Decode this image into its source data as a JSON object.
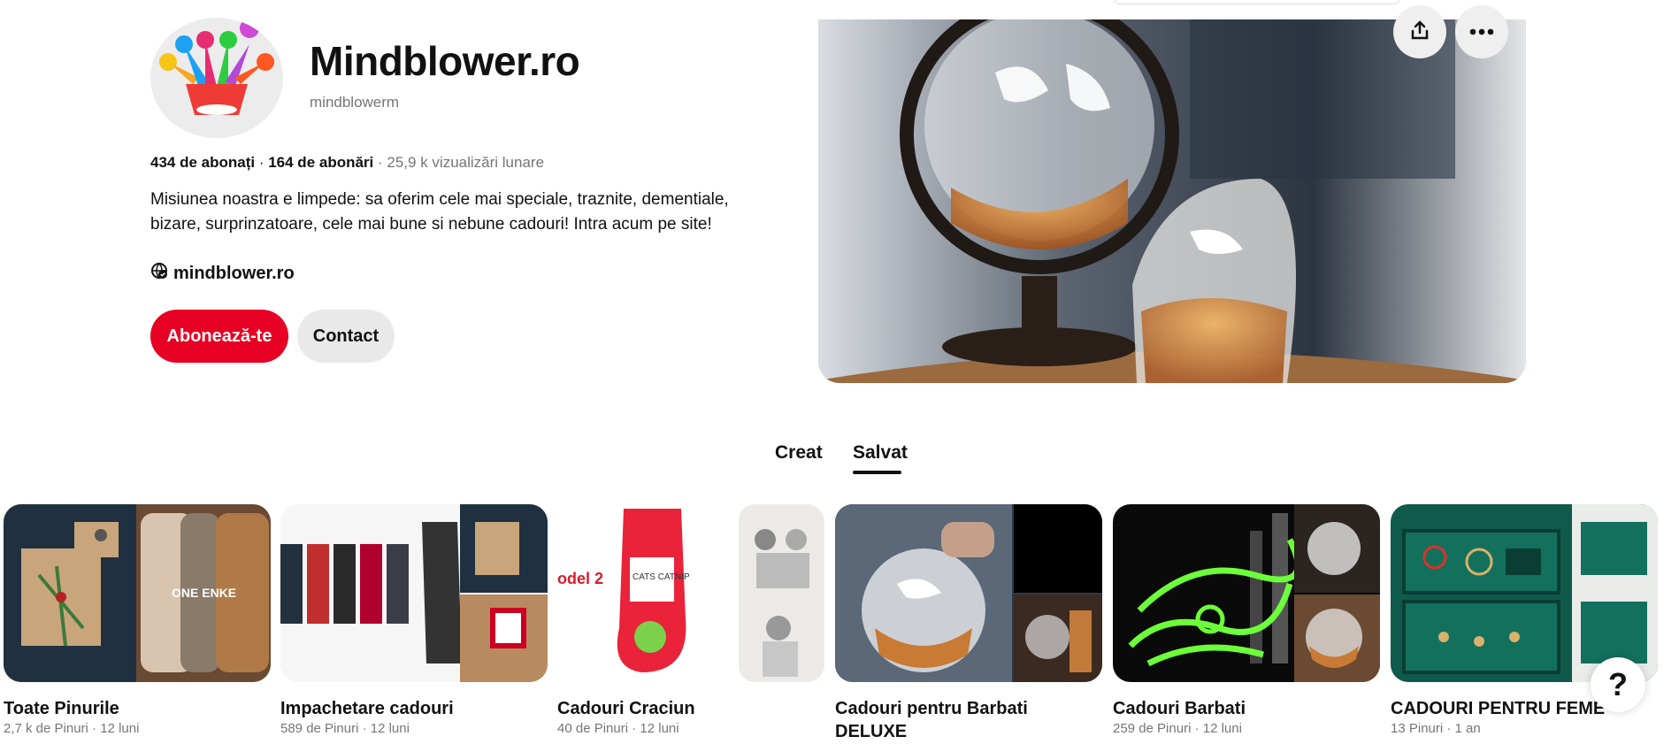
{
  "profile": {
    "name": "Mindblower.ro",
    "handle": "mindblowerm",
    "followers": "434 de abonați",
    "following": "164 de abonări",
    "views": "25,9 k vizualizări lunare",
    "bio": "Misiunea noastra e limpede: sa oferim cele mai speciale, traznite, dementiale, bizare, surprinzatoare, cele mai bune si nebune cadouri! Intra acum pe site!",
    "website": "mindblower.ro",
    "follow_label": "Abonează-te",
    "contact_label": "Contact"
  },
  "header_actions": {
    "share_icon": "share-icon",
    "more_icon": "more-icon"
  },
  "tabs": [
    {
      "label": "Creat"
    },
    {
      "label": "Salvat"
    }
  ],
  "boards": [
    {
      "title": "Toate Pinurile",
      "pins": "2,7 k de Pinuri",
      "age": "12 luni"
    },
    {
      "title": "Impachetare cadouri",
      "pins": "589 de Pinuri",
      "age": "12 luni"
    },
    {
      "title": "Cadouri Craciun",
      "pins": "40 de Pinuri",
      "age": "12 luni"
    },
    {
      "title": "Cadouri pentru Barbati DELUXE",
      "pins": "",
      "age": ""
    },
    {
      "title": "Cadouri Barbati",
      "pins": "259 de Pinuri",
      "age": "12 luni"
    },
    {
      "title": "CADOURI PENTRU FEME",
      "pins": "13 Pinuri",
      "age": "1 an"
    }
  ],
  "thumb_text": {
    "board1": "ONE ENKE",
    "board3_a": "odel 2",
    "board3_b": "CATS CATNIP"
  },
  "help_label": "?",
  "colors": {
    "brand": "#e60023",
    "muted": "#767676"
  }
}
